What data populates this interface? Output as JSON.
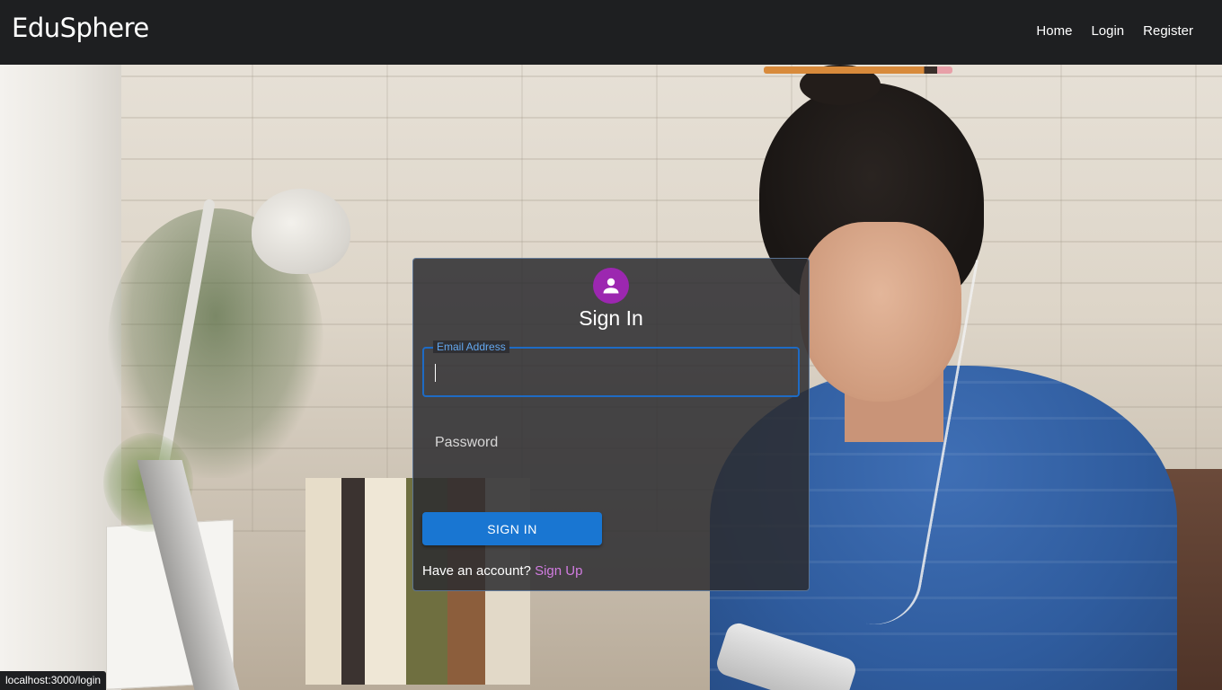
{
  "navbar": {
    "brand": "EduSphere",
    "links": [
      "Home",
      "Login",
      "Register"
    ]
  },
  "login_card": {
    "title": "Sign In",
    "email_label": "Email Address",
    "email_value": "",
    "password_label": "Password",
    "password_value": "",
    "submit_label": "SIGN IN",
    "account_prompt": "Have an account?",
    "signup_link": "Sign Up"
  },
  "status_bar": {
    "url": "localhost:3000/login"
  },
  "icons": {
    "avatar": "person-icon"
  },
  "colors": {
    "navbar_bg": "#1e1f21",
    "avatar_bg": "#9c27b0",
    "primary_button": "#1976d2",
    "focused_field": "#1e6bc4",
    "signup_link": "#d17ce0"
  }
}
